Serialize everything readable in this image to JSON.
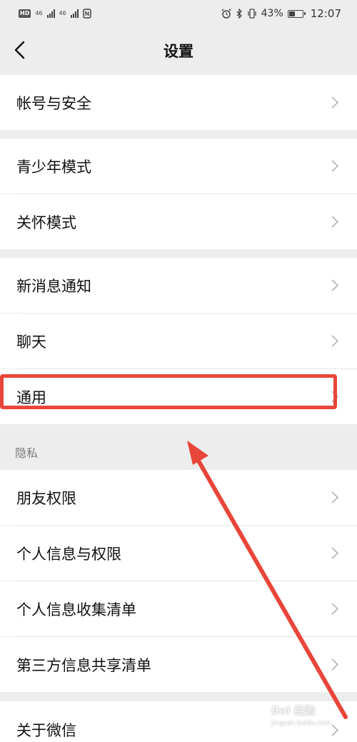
{
  "status_bar": {
    "left_badge": "HD",
    "sim1": "46",
    "sim2": "46",
    "battery_percent": "43%",
    "time": "12:07",
    "icons": [
      "alarm-icon",
      "bluetooth-icon",
      "vibrate-icon",
      "battery-icon",
      "nfc-icon"
    ]
  },
  "nav": {
    "title": "设置",
    "back_icon": "chevron-left-icon"
  },
  "groups": [
    {
      "items": [
        {
          "label": "帐号与安全"
        }
      ]
    },
    {
      "items": [
        {
          "label": "青少年模式"
        },
        {
          "label": "关怀模式"
        }
      ]
    },
    {
      "items": [
        {
          "label": "新消息通知"
        },
        {
          "label": "聊天"
        },
        {
          "label": "通用"
        }
      ]
    },
    {
      "header": "隐私",
      "items": [
        {
          "label": "朋友权限"
        },
        {
          "label": "个人信息与权限"
        },
        {
          "label": "个人信息收集清单"
        },
        {
          "label": "第三方信息共享清单"
        }
      ]
    },
    {
      "items": [
        {
          "label": "关于微信"
        }
      ]
    }
  ],
  "annotation": {
    "highlight_color": "#e8463a",
    "highlighted_item": "通用"
  },
  "watermark": {
    "text": "Bai 经验",
    "url": "jingyan.baidu.com"
  },
  "colors": {
    "page_bg": "#ededed",
    "row_bg": "#ffffff",
    "divider": "#e5e5e5",
    "section_header_text": "#7a7a7a"
  }
}
